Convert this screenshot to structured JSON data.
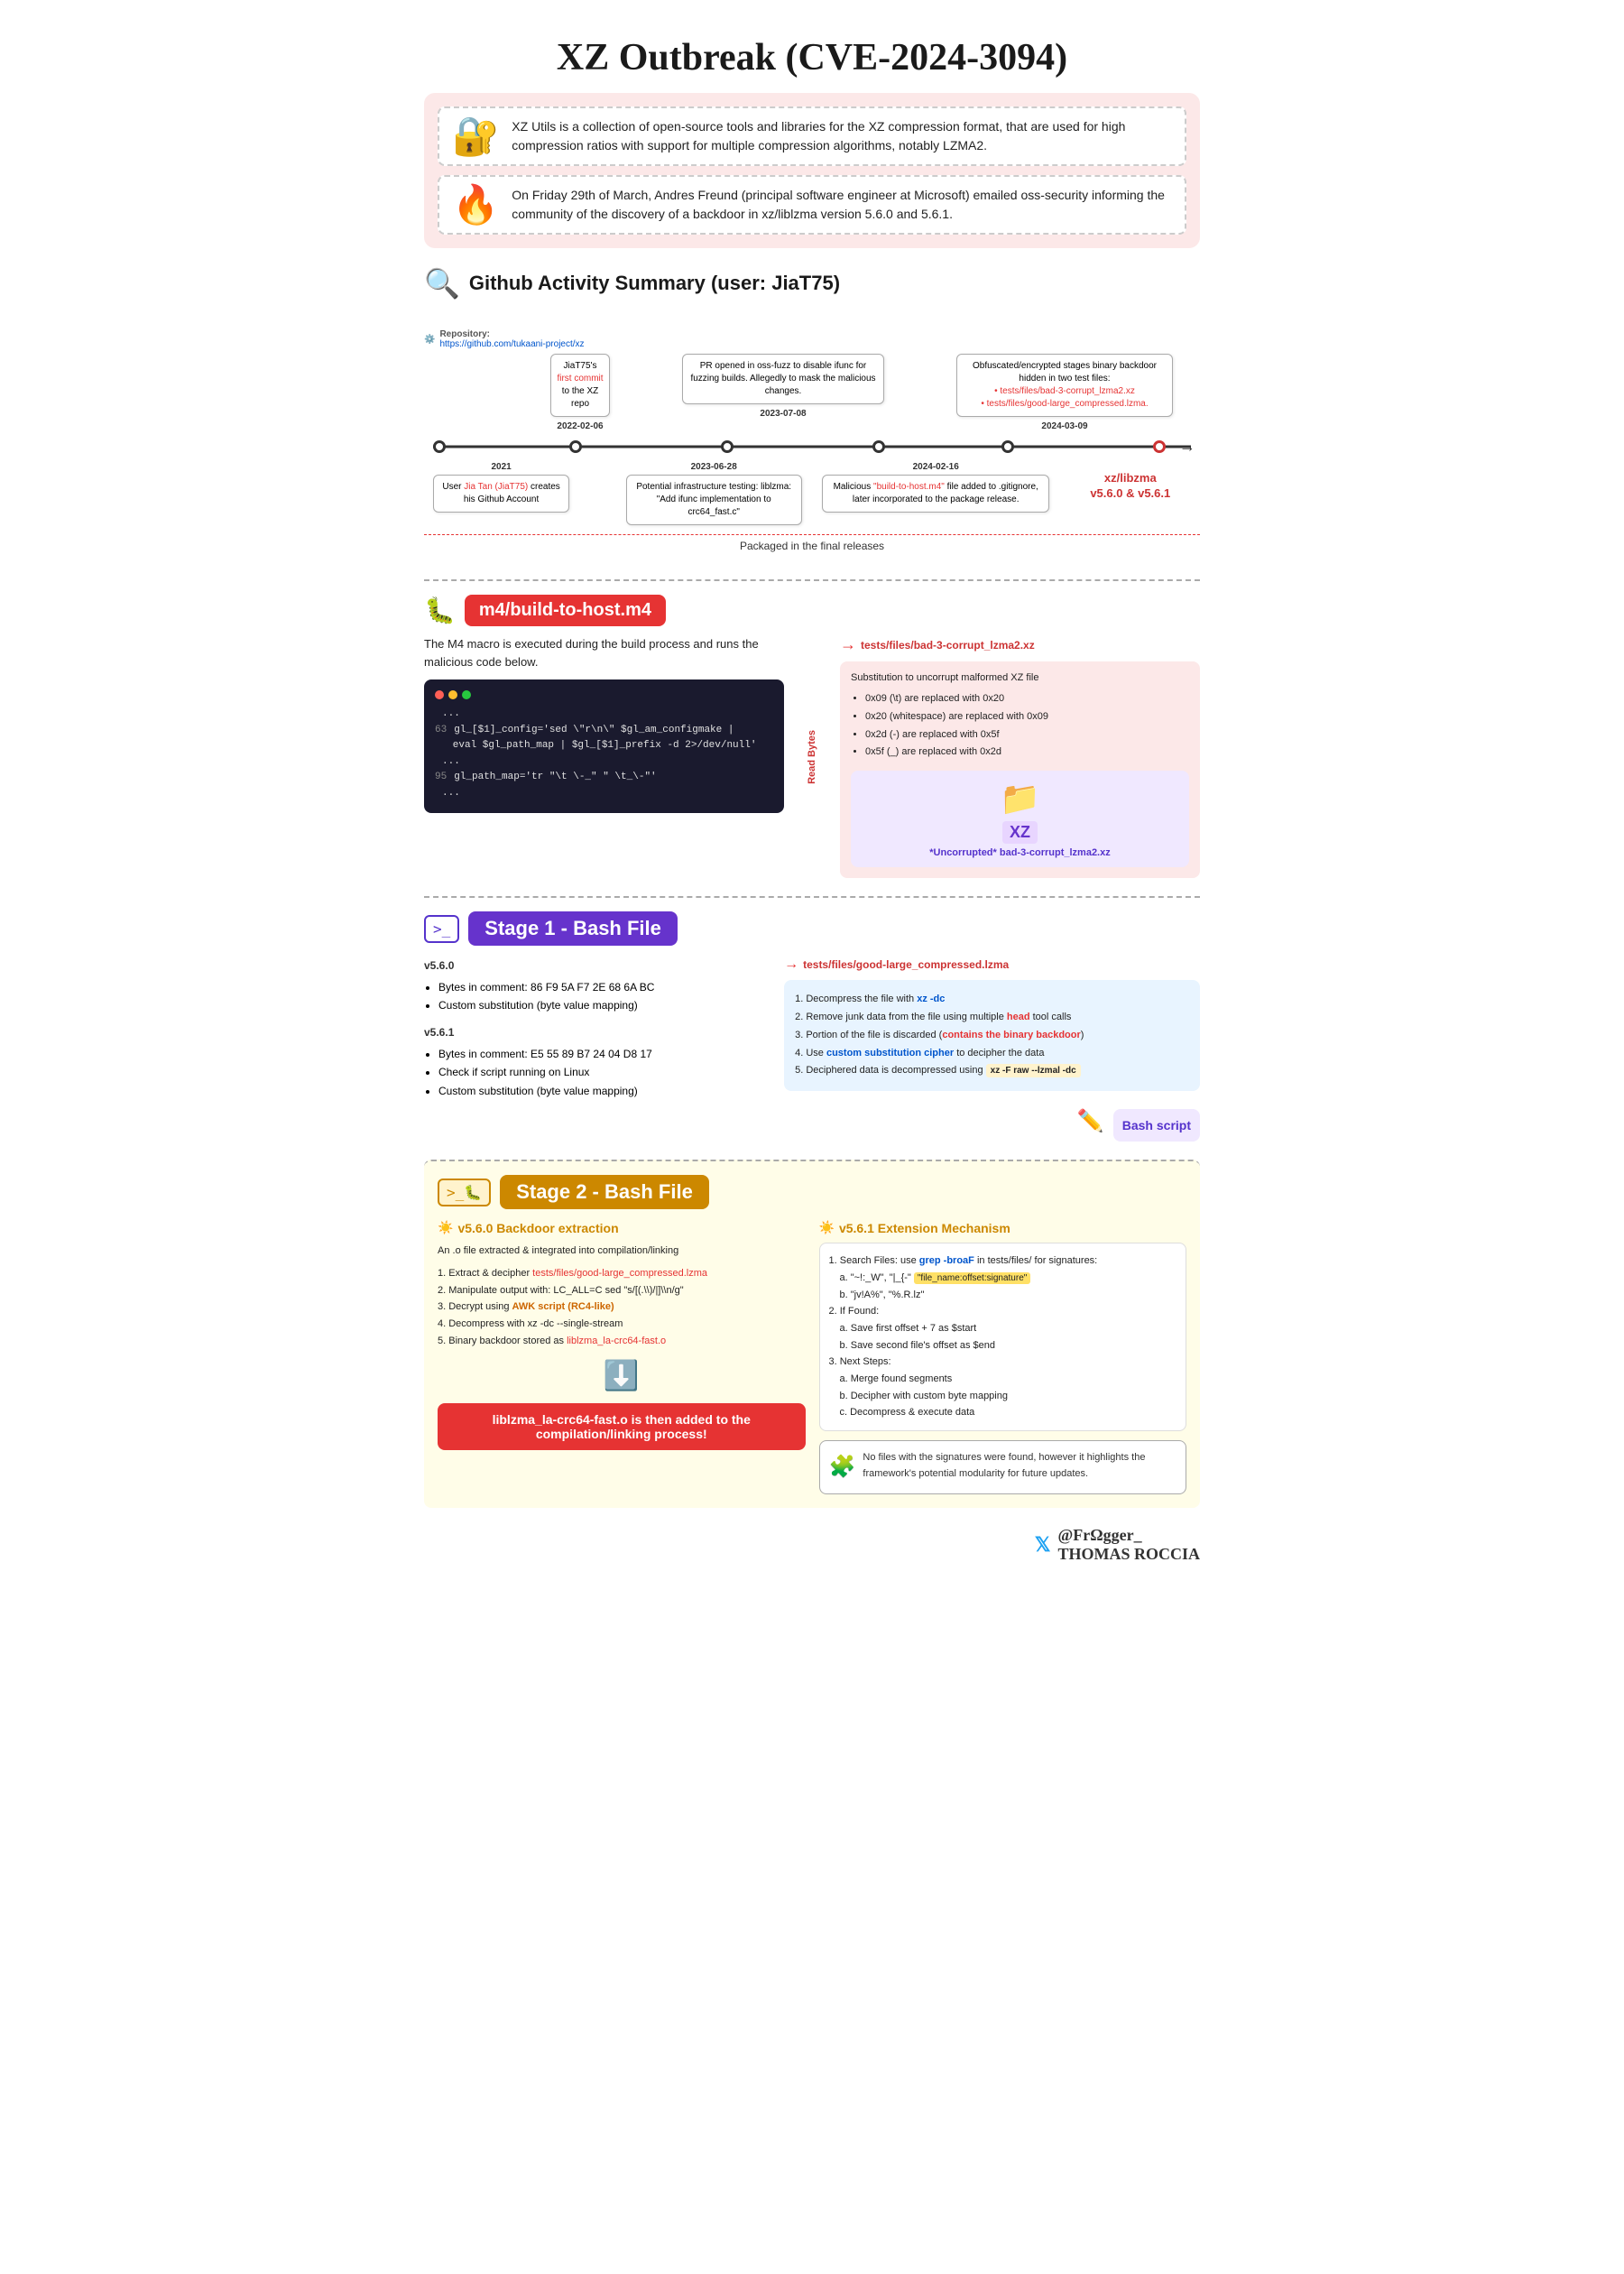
{
  "title": "XZ Outbreak (CVE-2024-3094)",
  "intro": {
    "xz_desc": "XZ Utils is a collection of open-source tools and libraries for the XZ compression format, that are used for high compression ratios with support for multiple compression algorithms, notably LZMA2.",
    "discovery": "On Friday 29th of March, Andres Freund (principal software engineer at Microsoft) emailed oss-security informing the community of the discovery of a backdoor in xz/liblzma version 5.6.0 and 5.6.1."
  },
  "github": {
    "title": "Github Activity Summary (user: JiaT75)",
    "repo_label": "Repository:",
    "repo_url": "https://github.com/tukaani-project/xz",
    "nodes": [
      {
        "date": "2021",
        "label": "User Jia Tan (JiaT75) creates his Github Account",
        "position": "below"
      },
      {
        "date": "2022-02-06",
        "label": "JiaT75's first commit to the XZ repo",
        "position": "above",
        "first_commit_red": "first commit"
      },
      {
        "date": "2023-07-08",
        "label": "PR opened in oss-fuzz to disable ifunc for fuzzing builds. Allegedly to mask the malicious changes.",
        "position": "above"
      },
      {
        "date": "2024-03-09",
        "label": "Obfuscated/encrypted stages binary backdoor hidden in two test files: tests/files/bad-3-corrupt_lzma2.xz | tests/files/good-large_compressed.lzma.",
        "position": "above"
      },
      {
        "date": "2023-06-28",
        "label": "Potential infrastructure testing: liblzma: \"Add ifunc implementation to crc64_fast.c\"",
        "position": "below"
      },
      {
        "date": "2024-02-16",
        "label": "Malicious \"build-to-host.m4\" file added to .gitignore, later incorporated to the package release.",
        "position": "below"
      }
    ],
    "packaged_label": "Packaged in the final releases",
    "xz_libzma_version": "xz/libzma v5.6.0 & v5.6.1"
  },
  "m4": {
    "badge": "m4/build-to-host.m4",
    "desc": "The M4 macro is executed during the build process and runs the malicious code below.",
    "code_lines": [
      "...",
      "63 gl_[$1]_config='sed \\\"r\\\\n\\\" $gl_am_configmake |",
      "   eval $gl_path_map | $gl_[$1]_prefix -d 2>/dev/null'",
      "...",
      "95 gl_path_map='tr \\\"\\\\t \\\\-_\\\" \\\" \\\\t_\\\\-\\\"'"
    ],
    "corrupt_file": "tests/files/bad-3-corrupt_lzma2.xz",
    "corrupt_desc": "Substitution to uncorrupt malformed XZ file",
    "corrupt_items": [
      "0x09 (\\t) are replaced with 0x20",
      "0x20 (whitespace) are replaced with 0x09",
      "0x2d (-) are replaced with 0x5f",
      "0x5f (_) are replaced with 0x2d"
    ],
    "uncorrupted_label": "*Uncorrupted* bad-3-corrupt_lzma2.xz",
    "read_bytes": "Read Bytes"
  },
  "stage1": {
    "badge": "Stage 1 - Bash File",
    "file": "tests/files/good-large_compressed.lzma",
    "v560": {
      "label": "v5.6.0",
      "items": [
        "Bytes in comment: 86 F9 5A F7 2E 68 6A BC",
        "Custom substitution (byte value mapping)"
      ]
    },
    "v561": {
      "label": "v5.6.1",
      "items": [
        "Bytes in comment: E5 55 89 B7 24 04 D8 17",
        "Check if script running on Linux",
        "Custom substitution (byte value mapping)"
      ]
    },
    "steps": [
      "Decompress the file with xz -dc",
      "Remove junk data from the file using multiple head tool calls",
      "Portion of the file is discarded (contains the binary backdoor)",
      "Use custom substitution cipher to decipher the data",
      "Deciphered data is decompressed using xz -F raw --lzmal -dc"
    ],
    "bash_script_label": "Bash script",
    "step3_red": "contains the binary backdoor",
    "step4_blue": "custom substitution cipher",
    "step2_red": "head",
    "step5_highlight": "xz -F raw --lzmal -dc"
  },
  "stage2": {
    "badge": "Stage 2 - Bash File",
    "v560_title": "v5.6.0 Backdoor extraction",
    "v560_desc": "An .o file extracted & integrated into compilation/linking",
    "v560_steps": [
      "Extract & decipher tests/files/good-large_compressed.lzma",
      "Manipulate output with: LC_ALL=C sed \"s/[(.\\\\)/|]\\\\n/g\"",
      "Decrypt using AWK script (RC4-like)",
      "Decompress with xz -dc --single-stream",
      "Binary backdoor stored as liblzma_la-crc64-fast.o"
    ],
    "footer_badge": "liblzma_la-crc64-fast.o is then added to the compilation/linking process!",
    "v561_title": "v5.6.1 Extension Mechanism",
    "v561_steps_intro": "Search Files: use grep -broaF in tests/files/ for signatures:",
    "v561_sig_a": "a. \"~!:_W\", \"|_}{-\" \"file_name:offset:signature\"",
    "v561_sig_b": "b. \"jv!A%\", \"%.R.lz\"",
    "v561_if_found": "If Found:",
    "v561_found_a": "a. Save first offset + 7 as $start",
    "v561_found_b": "b. Save second file's offset as $end",
    "v561_next": "Next Steps:",
    "v561_next_a": "a. Merge found segments",
    "v561_next_b": "b. Decipher with custom byte mapping",
    "v561_next_c": "c. Decompress & execute data",
    "side_note": "No files with the signatures were found, however it highlights the framework's potential modularity for future updates."
  },
  "footer": {
    "twitter": "𝕏",
    "handle": "@FrΩgger_",
    "author": "Thomas Roccia"
  }
}
